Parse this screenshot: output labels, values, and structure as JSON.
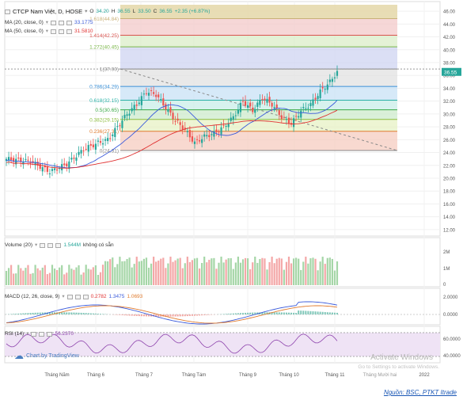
{
  "header": {
    "symbol": "CTCP Nam Việt, D, HOSE",
    "o_label": "O",
    "o_val": "34.20",
    "h_label": "H",
    "h_val": "36.55",
    "l_label": "L",
    "l_val": "33.50",
    "c_label": "C",
    "c_val": "36.55",
    "change": "+2.35 (+6.87%)"
  },
  "indicators": {
    "ma20_label": "MA (20, close, 0)",
    "ma20_val": "33.1775",
    "ma50_label": "MA (50, close, 0)",
    "ma50_val": "31.5810",
    "volume_label": "Volume (20)",
    "volume_val": "1.544M",
    "volume_na": "không có sẵn",
    "macd_label": "MACD (12, 26, close, 9)",
    "macd_v1": "0.2782",
    "macd_v2": "1.3475",
    "macd_v3": "1.0693",
    "rsi_label": "RSI (14)",
    "rsi_val": "56.2370"
  },
  "colors": {
    "up": "#26a69a",
    "down": "#ef5350",
    "ma20": "#3b5bdb",
    "ma50": "#e03131",
    "vol_up": "#a5d6a7",
    "vol_down": "#f4a7a7",
    "rsi": "#8e44ad",
    "accent": "#1a57b5"
  },
  "price_axis": [
    "46.00",
    "44.00",
    "42.00",
    "40.00",
    "38.00",
    "36.00",
    "34.00",
    "32.00",
    "30.00",
    "28.00",
    "26.00",
    "24.00",
    "22.00",
    "20.00",
    "18.00",
    "16.00",
    "14.00",
    "12.00"
  ],
  "last_price_tag": "36.55",
  "volume_axis": [
    "2M",
    "1M",
    "0"
  ],
  "macd_axis": [
    "2.0000",
    "0.0000"
  ],
  "rsi_axis": [
    "60.0000",
    "40.0000"
  ],
  "fib_levels": [
    {
      "label": "1.618(44.84)",
      "color": "#c9b178"
    },
    {
      "label": "1.414(42.25)",
      "color": "#d9534f"
    },
    {
      "label": "1.272(40.45)",
      "color": "#7ab648"
    },
    {
      "label": "1(37.00)",
      "color": "#888888"
    },
    {
      "label": "0.786(34.29)",
      "color": "#3a8fd6"
    },
    {
      "label": "0.618(32.15)",
      "color": "#2bb3a8"
    },
    {
      "label": "0.5(30.65)",
      "color": "#39a845"
    },
    {
      "label": "0.382(29.15)",
      "color": "#8cbd3e"
    },
    {
      "label": "0.236(27.31)",
      "color": "#e07b2e"
    },
    {
      "label": "0(24.31)",
      "color": "#888888"
    }
  ],
  "time_axis": [
    "Tháng Năm",
    "Tháng 6",
    "Tháng 7",
    "Tháng Tám",
    "Tháng 9",
    "Tháng 10",
    "Tháng 11",
    "2022"
  ],
  "time_axis_extra": "Tháng Mười hai",
  "chart_link": "Chart by TradingView",
  "watermark": "Activate Windows",
  "watermark_sub": "Go to Settings to activate Windows.",
  "source": "Nguồn: BSC, PTKT Itrade",
  "chart_data": {
    "type": "candlestick",
    "title": "CTCP Nam Việt, D, HOSE",
    "ylim": [
      11,
      47
    ],
    "fib_values": [
      44.84,
      42.25,
      40.45,
      37.0,
      34.29,
      32.15,
      30.65,
      29.15,
      27.31,
      24.31
    ],
    "last_close": 36.55,
    "series": [
      {
        "name": "MA (20, close, 0)",
        "last": 33.1775
      },
      {
        "name": "MA (50, close, 0)",
        "last": 31.581
      },
      {
        "name": "Volume (20)",
        "last": 1544000
      },
      {
        "name": "MACD (12, 26, close, 9)",
        "values": [
          0.2782,
          1.3475,
          1.0693
        ]
      },
      {
        "name": "RSI (14)",
        "last": 56.237
      }
    ]
  }
}
